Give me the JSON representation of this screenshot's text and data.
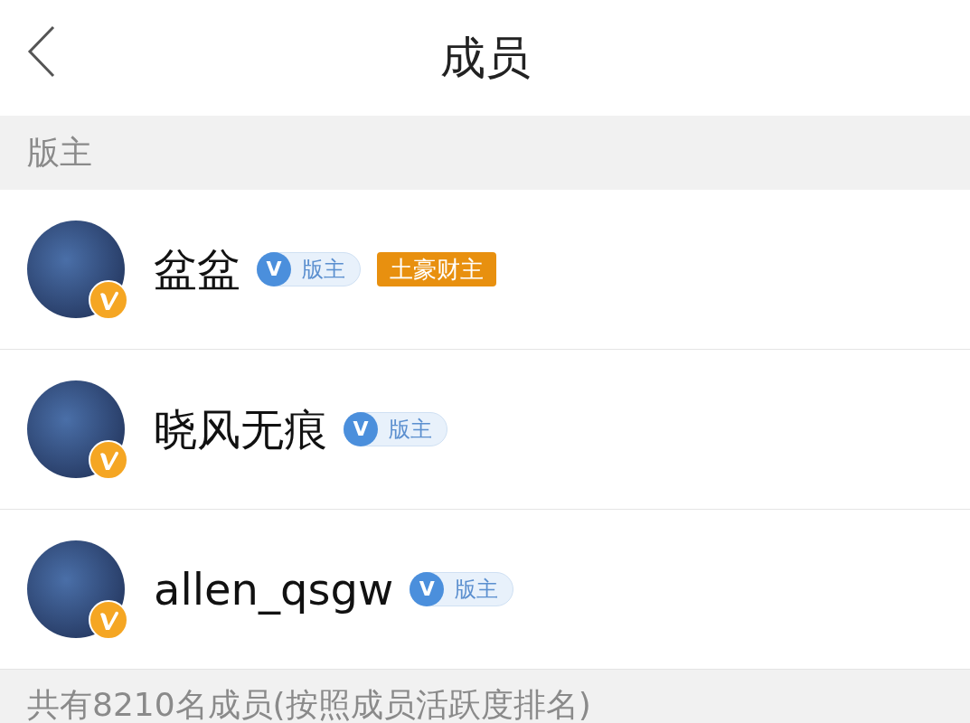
{
  "header": {
    "title": "成员"
  },
  "sections": [
    {
      "title": "版主",
      "members": [
        {
          "name": "盆盆",
          "role": {
            "icon_letter": "V",
            "label": "版主"
          },
          "tags": [
            "土豪财主"
          ]
        },
        {
          "name": "晓风无痕",
          "role": {
            "icon_letter": "V",
            "label": "版主"
          }
        },
        {
          "name": "allen_qsgw",
          "role": {
            "icon_letter": "V",
            "label": "版主"
          }
        }
      ]
    },
    {
      "title": "共有8210名成员(按照成员活跃度排名)"
    }
  ]
}
